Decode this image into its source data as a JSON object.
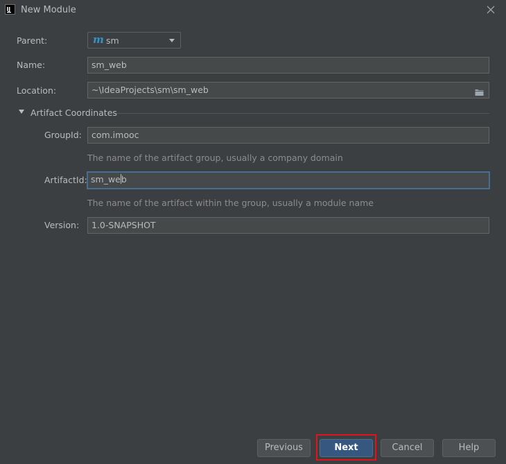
{
  "window": {
    "title": "New Module",
    "app_icon_letters": "IJ"
  },
  "form": {
    "parent": {
      "label": "Parent:",
      "value": "sm",
      "icon": "maven-m-icon",
      "icon_glyph": "m"
    },
    "name": {
      "label": "Name:",
      "value": "sm_web"
    },
    "location": {
      "label": "Location:",
      "value": "~\\IdeaProjects\\sm\\sm_web",
      "icon": "folder-icon"
    }
  },
  "artifact": {
    "section_title": "Artifact Coordinates",
    "expanded": true,
    "group_id": {
      "label": "GroupId:",
      "value": "com.imooc",
      "hint": "The name of the artifact group, usually a company domain"
    },
    "artifact_id": {
      "label": "ArtifactId:",
      "value_before_caret": "sm_we",
      "value_after_caret": "b",
      "hint": "The name of the artifact within the group, usually a module name"
    },
    "version": {
      "label": "Version:",
      "value": "1.0-SNAPSHOT"
    }
  },
  "buttons": {
    "previous": "Previous",
    "next": "Next",
    "cancel": "Cancel",
    "help": "Help"
  },
  "colors": {
    "background": "#3c3f41",
    "field_background": "#45494a",
    "focus_border": "#466d94",
    "primary_button": "#365880",
    "highlight": "#e0141e",
    "maven_blue": "#3592c4"
  }
}
